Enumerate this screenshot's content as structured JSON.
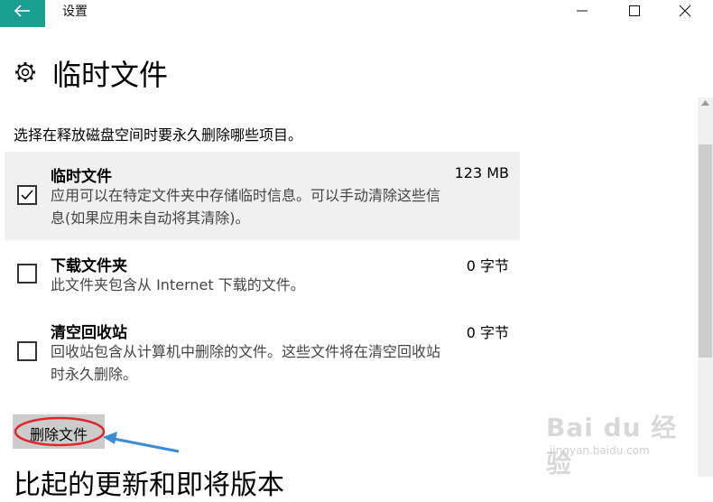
{
  "window": {
    "title": "设置",
    "back_icon": "arrow-left-icon",
    "controls": [
      "minimize-icon",
      "maximize-icon",
      "close-icon"
    ],
    "accent": "#1a9e8f"
  },
  "header": {
    "icon": "gear-icon",
    "title": "临时文件"
  },
  "instruction": "选择在释放磁盘空间时要永久删除哪些项目。",
  "items": [
    {
      "title": "临时文件",
      "size": "123 MB",
      "checked": true,
      "desc_line1": "应用可以在特定文件夹中存储临时信息。可以手动清除这些信",
      "desc_line2": "息(如果应用未自动将其清除)。"
    },
    {
      "title": "下载文件夹",
      "size": "0 字节",
      "checked": false,
      "desc_line1": "此文件夹包含从 Internet 下载的文件。"
    },
    {
      "title": "清空回收站",
      "size": "0 字节",
      "checked": false,
      "desc_line1": "回收站包含从计算机中删除的文件。这些文件将在清空回收站",
      "desc_line2": "时永久删除。"
    }
  ],
  "delete_button": {
    "label": "删除文件"
  },
  "partial_heading": "比起的更新和即将版本",
  "annotation": {
    "color": "#e0262b",
    "arrow_color": "#3a8ad6"
  },
  "watermark": {
    "logo": "Bai du 经验",
    "url": "jingyan.baidu.com"
  }
}
